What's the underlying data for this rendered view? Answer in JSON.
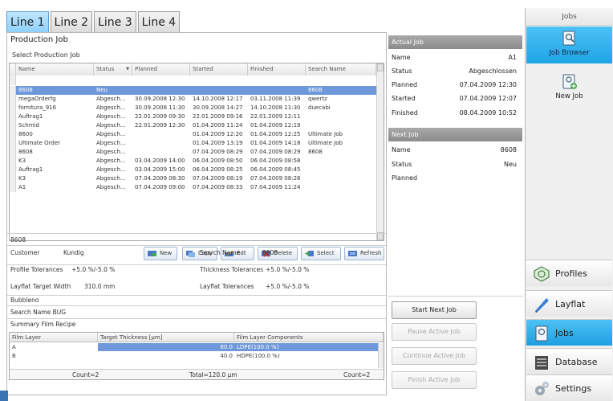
{
  "tabs": [
    "Line 1",
    "Line 2",
    "Line 3",
    "Line 4"
  ],
  "production": {
    "title": "Production Job",
    "select_label": "Select Production Job",
    "columns": [
      "Name",
      "Status",
      "Planned",
      "Started",
      "Finished",
      "Search Name"
    ],
    "status_sort_glyph": "▼",
    "rows": [
      {
        "name": "8608",
        "status": "Neu",
        "planned": "",
        "started": "",
        "finished": "",
        "search": "8608"
      },
      {
        "name": "megaOrderfg",
        "status": "Abgesch...",
        "planned": "30.09.2008 12:30",
        "started": "14.10.2008 12:17",
        "finished": "03.11.2008 11:39",
        "search": "qwertz"
      },
      {
        "name": "fornitura_916",
        "status": "Abgesch...",
        "planned": "30.09.2008 11:30",
        "started": "30.09.2008 14:27",
        "finished": "14.10.2008 11:30",
        "search": "duecabi"
      },
      {
        "name": "Auftrag1",
        "status": "Abgesch...",
        "planned": "22.01.2009 09:30",
        "started": "22.01.2009 09:16",
        "finished": "22.01.2009 12:11",
        "search": ""
      },
      {
        "name": "Schmid",
        "status": "Abgesch...",
        "planned": "22.01.2009 12:30",
        "started": "01.04.2009 11:24",
        "finished": "01.04.2009 12:19",
        "search": ""
      },
      {
        "name": "8600",
        "status": "Abgesch...",
        "planned": "",
        "started": "01.04.2009 12:20",
        "finished": "01.04.2009 12:25",
        "search": "Ultimate Job"
      },
      {
        "name": "Ultimate Order",
        "status": "Abgesch...",
        "planned": "",
        "started": "01.04.2009 13:19",
        "finished": "01.04.2009 14:18",
        "search": "Ultimate Job"
      },
      {
        "name": "8608",
        "status": "Abgesch...",
        "planned": "",
        "started": "07.04.2009 08:29",
        "finished": "07.04.2009 08:29",
        "search": "8608"
      },
      {
        "name": "K3",
        "status": "Abgesch...",
        "planned": "03.04.2009 14:00",
        "started": "06.04.2009 08:50",
        "finished": "06.04.2009 08:58",
        "search": ""
      },
      {
        "name": "Auftrag1",
        "status": "Abgesch...",
        "planned": "03.04.2009 15:00",
        "started": "06.04.2009 08:25",
        "finished": "06.04.2009 08:45",
        "search": ""
      },
      {
        "name": "K3",
        "status": "Abgesch...",
        "planned": "07.04.2009 08:30",
        "started": "07.04.2009 08:19",
        "finished": "07.04.2009 08:26",
        "search": ""
      },
      {
        "name": "A1",
        "status": "Abgesch...",
        "planned": "07.04.2009 09:00",
        "started": "07.04.2009 08:33",
        "finished": "07.04.2009 11:24",
        "search": ""
      }
    ],
    "buttons": {
      "new": "New",
      "copy": "Copy",
      "edit": "Edt",
      "delete": "Delete",
      "select": "Select",
      "refresh": "Refresh"
    }
  },
  "details": {
    "job_name": "8608",
    "customer_label": "Customer",
    "customer_value": "Kundig",
    "search_name_label": "Search Name",
    "search_name_value": "8608",
    "profile_tol_label": "Profile Tolerances",
    "profile_tol_value": "+5.0 %/-5.0 %",
    "thickness_tol_label": "Thickness Tolerances",
    "thickness_tol_value": "+5.0 %/-5.0 %",
    "layflat_width_label": "Layflat Target Width",
    "layflat_width_value": "310.0 mm",
    "layflat_tol_label": "Layflat Tolerances",
    "layflat_tol_value": "+5.0 %/-5.0 %",
    "recipe_name": "Bubbleno",
    "recipe_search_line": "Search Name BUG",
    "summary_label": "Summary Film Recipe"
  },
  "recipe": {
    "columns": [
      "Film Layer",
      "Target Thickness [µm]",
      "Film Layer Components"
    ],
    "rows": [
      {
        "layer": "A",
        "thickness": "80.0",
        "component": "LDPE(100.0 %)"
      },
      {
        "layer": "B",
        "thickness": "40.0",
        "component": "HDPE(100.0 %)"
      }
    ],
    "count_left": "Count=2",
    "total": "Total=120.0 µm",
    "count_right": "Count=2"
  },
  "actual_job": {
    "header": "Actual Job",
    "labels": [
      "Name",
      "Status",
      "Planned",
      "Started",
      "Finished"
    ],
    "values": [
      "A1",
      "Abgeschlossen",
      "07.04.2009 12:30",
      "07.04.2009 12:07",
      "08.04.2009 10:52"
    ]
  },
  "next_job": {
    "header": "Next Job",
    "labels": [
      "Name",
      "Status",
      "Planned"
    ],
    "values": [
      "8608",
      "Neu",
      ""
    ]
  },
  "commands": {
    "start": "Start Next Job",
    "pause": "Pause Active Job",
    "continue": "Continue Active Job",
    "finish": "Finish Active Job"
  },
  "nav": {
    "title": "Jobs",
    "job_browser": "Job Browser",
    "new_job": "New Job",
    "items": [
      "Profiles",
      "Layflat",
      "Jobs",
      "Database",
      "Settings"
    ]
  },
  "colors": {
    "accent": "#1fa5e5",
    "selection": "#6f98da",
    "header_gray": "#8b8b8b"
  }
}
